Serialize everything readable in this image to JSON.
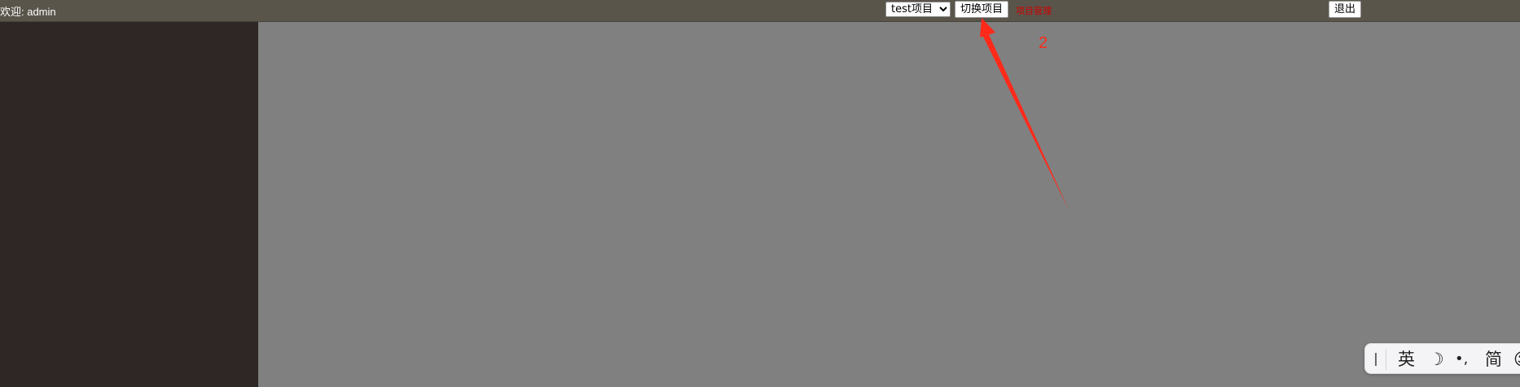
{
  "header": {
    "welcome_text": "欢迎: admin",
    "project_select": {
      "selected": "test项目",
      "options": [
        "test项目"
      ]
    },
    "switch_button_label": "切换项目",
    "red_link_text": "项目管理",
    "logout_button_label": "退出"
  },
  "annotation": {
    "label": "2",
    "color": "#ff2a1a"
  },
  "ime_toolbar": {
    "language_label": "英",
    "moon_glyph": "☽",
    "punct_glyph": "•,",
    "mode_label": "简",
    "emoji_glyph": "☺"
  },
  "colors": {
    "topbar": "#5a554b",
    "sidebar": "#2e2726",
    "main": "#808080"
  }
}
